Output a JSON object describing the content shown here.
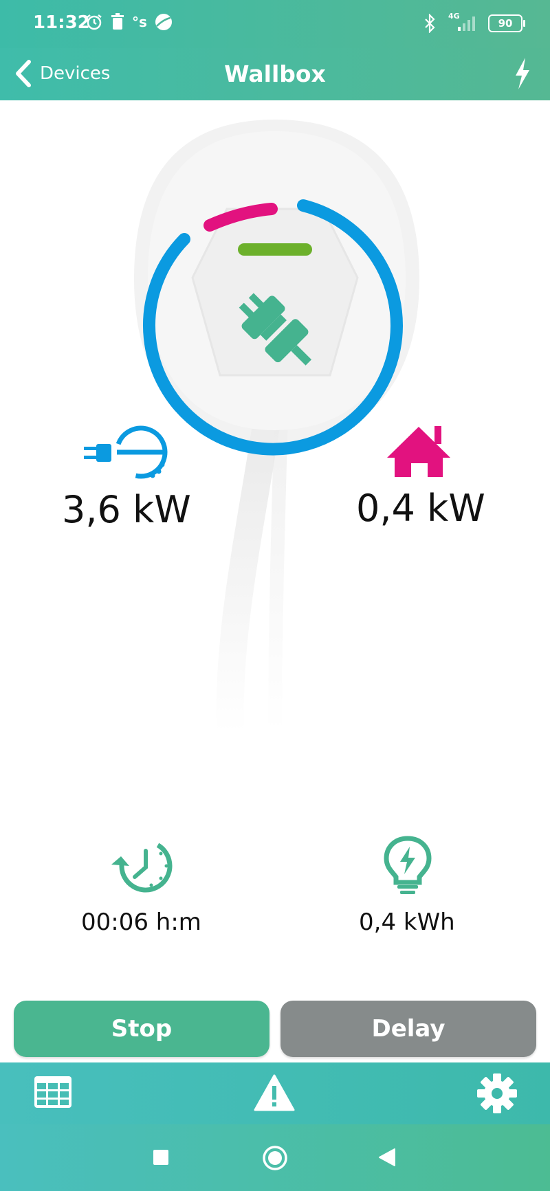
{
  "status_bar": {
    "time": "11:32",
    "network": "4G",
    "battery": "90",
    "icons": [
      "alarm-icon",
      "trash-icon",
      "os-icon",
      "ball-icon",
      "bluetooth-icon",
      "signal-icon",
      "battery-icon"
    ]
  },
  "header": {
    "back_label": "Devices",
    "title": "Wallbox",
    "right_icon": "bolt-icon"
  },
  "metrics": {
    "car_power": "3,6 kW",
    "house_power": "0,4 kW"
  },
  "stats": {
    "duration": "00:06 h:m",
    "energy": "0,4 kWh"
  },
  "buttons": {
    "stop": "Stop",
    "delay": "Delay"
  },
  "tab_bar": {
    "items": [
      "grid-icon",
      "warning-icon",
      "settings-icon"
    ]
  },
  "colors": {
    "accent_teal": "#4ab690",
    "ring_blue": "#0b9ae0",
    "magenta": "#e2127f",
    "green_led": "#6cb02b",
    "delay_gray": "#868b8b"
  }
}
